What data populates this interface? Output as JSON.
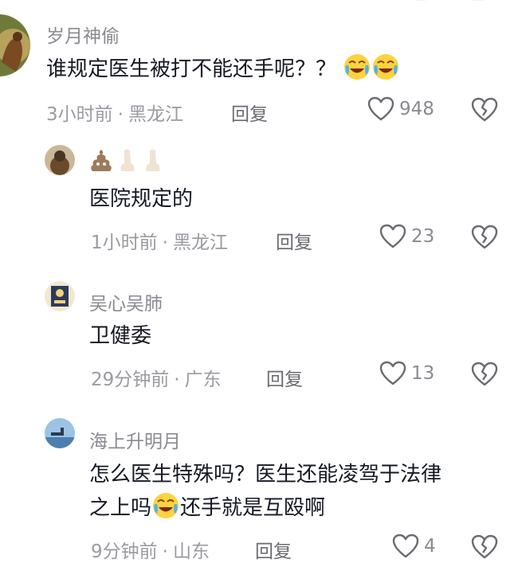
{
  "comments": [
    {
      "username": "岁月神偷",
      "text": "谁规定医生被打不能还手呢？？",
      "time": "3小时前",
      "location": "黑龙江",
      "reply_label": "回复",
      "likes": "948"
    },
    {
      "username": "",
      "text": "医院规定的",
      "time": "1小时前",
      "location": "黑龙江",
      "reply_label": "回复",
      "likes": "23"
    },
    {
      "username": "吴心吴肺",
      "text": "卫健委",
      "time": "29分钟前",
      "location": "广东",
      "reply_label": "回复",
      "likes": "13"
    },
    {
      "username": "海上升明月",
      "text_line1": "怎么医生特殊吗？医生还能凌驾于法律",
      "text_line2a": "之上吗",
      "text_line2b": "还手就是互殴啊",
      "time": "9分钟前",
      "location": "山东",
      "reply_label": "回复",
      "likes": "4"
    }
  ],
  "separator": "·",
  "icons": {
    "like": "heart-outline-icon",
    "dislike": "broken-heart-icon",
    "emoji": "crying-laughing-emoji"
  }
}
